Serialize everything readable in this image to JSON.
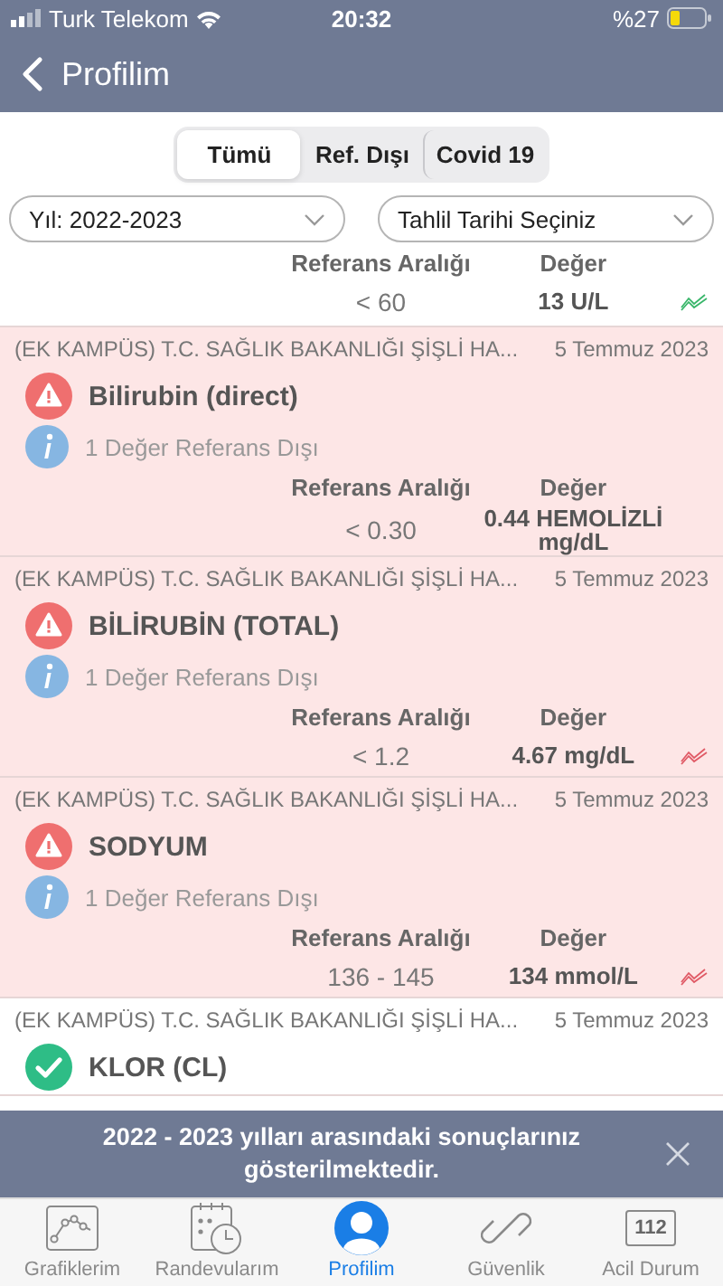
{
  "status_bar": {
    "carrier": "Turk Telekom",
    "time": "20:32",
    "battery": "%27"
  },
  "nav": {
    "title": "Profilim"
  },
  "segments": [
    {
      "label": "Tümü",
      "selected": true
    },
    {
      "label": "Ref. Dışı",
      "selected": false
    },
    {
      "label": "Covid 19",
      "selected": false
    }
  ],
  "filters": [
    {
      "value": "Yıl: 2022-2023"
    },
    {
      "placeholder": "Tahlil Tarihi Seçiniz"
    }
  ],
  "partial_result": {
    "range_label": "Referans Aralığı",
    "value_label": "Değer",
    "range": "< 60",
    "value": "13 U/L",
    "out_of_range": false,
    "trend": true
  },
  "results": [
    {
      "hospital": "(EK KAMPÜS) T.C. SAĞLIK BAKANLIĞI ŞİŞLİ HA...",
      "date": "5 Temmuz 2023",
      "out_of_range": true,
      "test": "Bilirubin (direct)",
      "info": "1 Değer Referans Dışı",
      "range_label": "Referans Aralığı",
      "value_label": "Değer",
      "range": "< 0.30",
      "value": "0.44 HEMOLİZLİ mg/dL",
      "trend": false
    },
    {
      "hospital": "(EK KAMPÜS) T.C. SAĞLIK BAKANLIĞI ŞİŞLİ HA...",
      "date": "5 Temmuz 2023",
      "out_of_range": true,
      "test": "BİLİRUBİN (TOTAL)",
      "info": "1 Değer Referans Dışı",
      "range_label": "Referans Aralığı",
      "value_label": "Değer",
      "range": "< 1.2",
      "value": "4.67 mg/dL",
      "trend": true
    },
    {
      "hospital": "(EK KAMPÜS) T.C. SAĞLIK BAKANLIĞI ŞİŞLİ HA...",
      "date": "5 Temmuz 2023",
      "out_of_range": true,
      "test": "SODYUM",
      "info": "1 Değer Referans Dışı",
      "range_label": "Referans Aralığı",
      "value_label": "Değer",
      "range": "136 - 145",
      "value": "134 mmol/L",
      "trend": true
    },
    {
      "hospital": "(EK KAMPÜS) T.C. SAĞLIK BAKANLIĞI ŞİŞLİ HA...",
      "date": "5 Temmuz 2023",
      "out_of_range": false,
      "test": "KLOR (CL)"
    }
  ],
  "toast": {
    "message": "2022 - 2023 yılları arasındaki sonuçlarınız gösterilmektedir."
  },
  "tab_bar": [
    {
      "kind": "chart",
      "label": "Grafiklerim",
      "selected": false
    },
    {
      "kind": "calendar",
      "label": "Randevularım",
      "selected": false
    },
    {
      "kind": "profile",
      "label": "Profilim",
      "selected": true
    },
    {
      "kind": "link",
      "label": "Güvenlik",
      "selected": false
    },
    {
      "kind": "emergency",
      "label": "Acil Durum",
      "badge": "112",
      "selected": false
    }
  ]
}
